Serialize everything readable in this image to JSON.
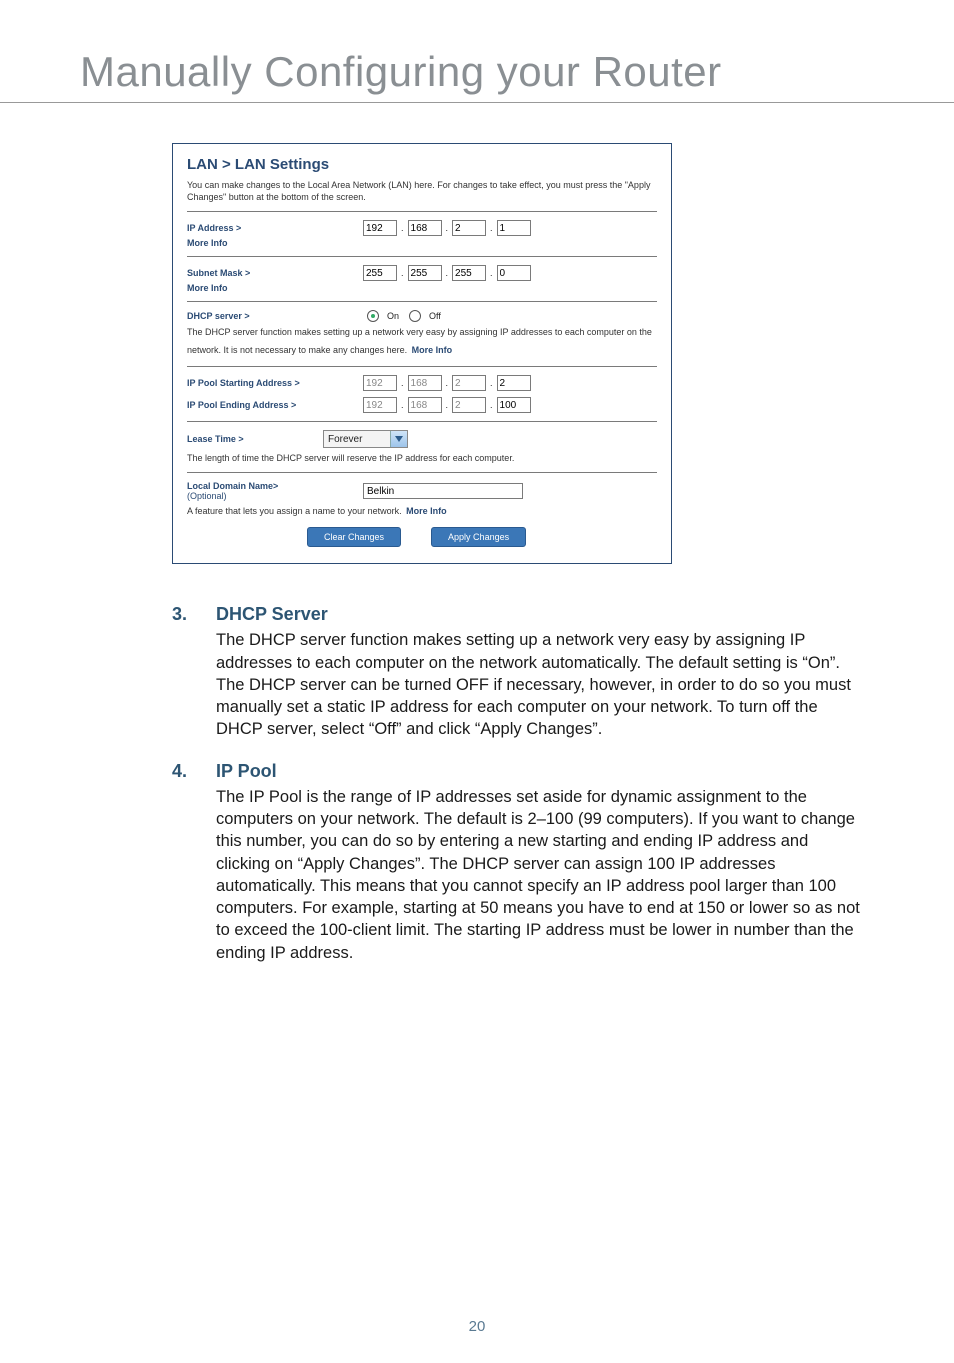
{
  "title": "Manually Configuring your Router",
  "page_number": "20",
  "screenshot": {
    "breadcrumb": "LAN > LAN Settings",
    "intro": "You can make changes to the Local Area Network (LAN) here. For changes to take effect, you must press the \"Apply Changes\" button at the bottom of the screen.",
    "ip_address": {
      "label": "IP Address >",
      "more": "More Info",
      "o1": "192",
      "o2": "168",
      "o3": "2",
      "o4": "1"
    },
    "subnet": {
      "label": "Subnet Mask >",
      "more": "More Info",
      "o1": "255",
      "o2": "255",
      "o3": "255",
      "o4": "0"
    },
    "dhcp": {
      "label": "DHCP server >",
      "on": "On",
      "off": "Off",
      "desc": "The DHCP server function makes setting up a network very easy by assigning IP addresses to each computer on the network. It is not necessary to make any changes here.",
      "more": "More Info"
    },
    "pool_start": {
      "label": "IP Pool Starting Address >",
      "o1": "192",
      "o2": "168",
      "o3": "2",
      "o4": "2"
    },
    "pool_end": {
      "label": "IP Pool Ending Address >",
      "o1": "192",
      "o2": "168",
      "o3": "2",
      "o4": "100"
    },
    "lease": {
      "label": "Lease Time >",
      "value": "Forever",
      "desc": "The length of time the DHCP server will reserve the IP address for each computer."
    },
    "domain": {
      "label": "Local Domain Name>",
      "sub": "(Optional)",
      "value": "Belkin",
      "desc": "A feature that lets you assign a name to your network.",
      "more": "More Info"
    },
    "buttons": {
      "clear": "Clear Changes",
      "apply": "Apply Changes"
    }
  },
  "sections": [
    {
      "num": "3.",
      "head": "DHCP Server",
      "body": "The DHCP server function makes setting up a network very easy by assigning IP addresses to each computer on the network automatically. The default setting is “On”. The DHCP server can be turned OFF if necessary, however, in order to do so you must manually set a static IP address for each computer on your network. To turn off the DHCP server, select “Off” and click “Apply Changes”."
    },
    {
      "num": "4.",
      "head": "IP Pool",
      "body": "The IP Pool is the range of IP addresses set aside for dynamic assignment to the computers on your network. The default is 2–100 (99 computers). If you want to change this number, you can do so by entering a new starting and ending IP address and clicking on “Apply Changes”. The DHCP server can assign 100 IP addresses automatically. This means that you cannot specify an IP address pool larger than 100 computers. For example, starting at 50 means you have to end at 150 or lower so as not to exceed the 100-client limit. The starting IP address must be lower in number than the ending IP address."
    }
  ]
}
